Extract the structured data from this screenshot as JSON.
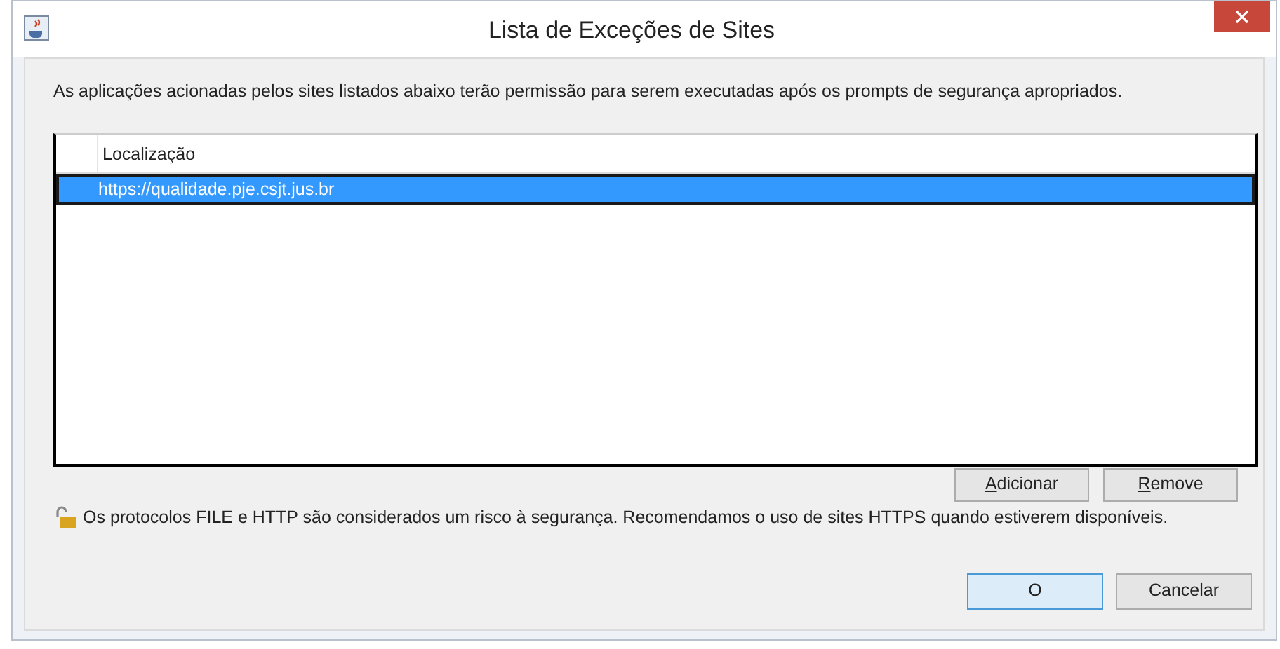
{
  "window": {
    "title": "Lista de Exceções de Sites"
  },
  "description": "As aplicações acionadas pelos sites listados abaixo terão permissão para serem executadas após os prompts de segurança apropriados.",
  "table": {
    "columns": [
      "Localização"
    ],
    "rows": [
      {
        "cells": [
          "https://qualidade.pje.csjt.jus.br"
        ],
        "selected": true
      }
    ]
  },
  "list_buttons": [
    "Adicionar",
    "Remove"
  ],
  "warning": "Os protocolos FILE e HTTP são considerados um risco à segurança. Recomendamos o uso de sites HTTPS quando estiverem disponíveis.",
  "dialog_buttons": [
    {
      "label": "O",
      "default": true
    },
    {
      "label": "Cancelar",
      "default": false
    }
  ]
}
